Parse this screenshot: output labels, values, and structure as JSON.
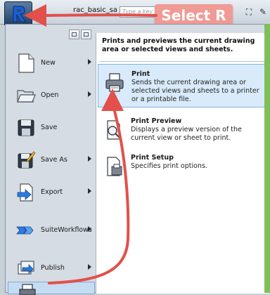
{
  "titlebar": {
    "qa_arrows": "▸▸",
    "title": "rac_basic_sa",
    "search_placeholder": "Type a key",
    "icons": [
      "binoculars-icon",
      "tool-icon"
    ]
  },
  "annotation": {
    "callout_text": "Select R",
    "arrow_color": "#e2504b"
  },
  "left_menu": {
    "items": [
      {
        "label": "New",
        "icon": "new-file-icon",
        "has_submenu": true
      },
      {
        "label": "Open",
        "icon": "folder-open-icon",
        "has_submenu": true
      },
      {
        "label": "Save",
        "icon": "floppy-disk-icon",
        "has_submenu": false
      },
      {
        "label": "Save As",
        "icon": "save-as-icon",
        "has_submenu": true
      },
      {
        "label": "Export",
        "icon": "export-icon",
        "has_submenu": true
      },
      {
        "label": "Suite Workflows",
        "label_line1": "Suite",
        "label_line2": "Workflows",
        "icon": "suite-workflows-icon",
        "has_submenu": true
      },
      {
        "label": "Publish",
        "icon": "publish-icon",
        "has_submenu": true
      },
      {
        "label": "",
        "icon": "print-icon",
        "has_submenu": false,
        "active": true
      }
    ]
  },
  "print_submenu": {
    "header": "Prints and previews the current drawing area or selected views and sheets.",
    "items": [
      {
        "title": "Print",
        "description": "Sends the current drawing area or selected views and sheets to a printer or a printable file.",
        "icon": "printer-icon",
        "highlighted": true
      },
      {
        "title": "Print Preview",
        "description": "Displays a preview version of the current view or sheet to print.",
        "icon": "print-preview-icon",
        "highlighted": false
      },
      {
        "title": "Print Setup",
        "description": "Specifies print options.",
        "icon": "print-setup-icon",
        "highlighted": false
      }
    ]
  },
  "colors": {
    "highlight": "#d9ebfb",
    "callout": "#f09a95",
    "accent_edge": "#7fbf5a"
  }
}
